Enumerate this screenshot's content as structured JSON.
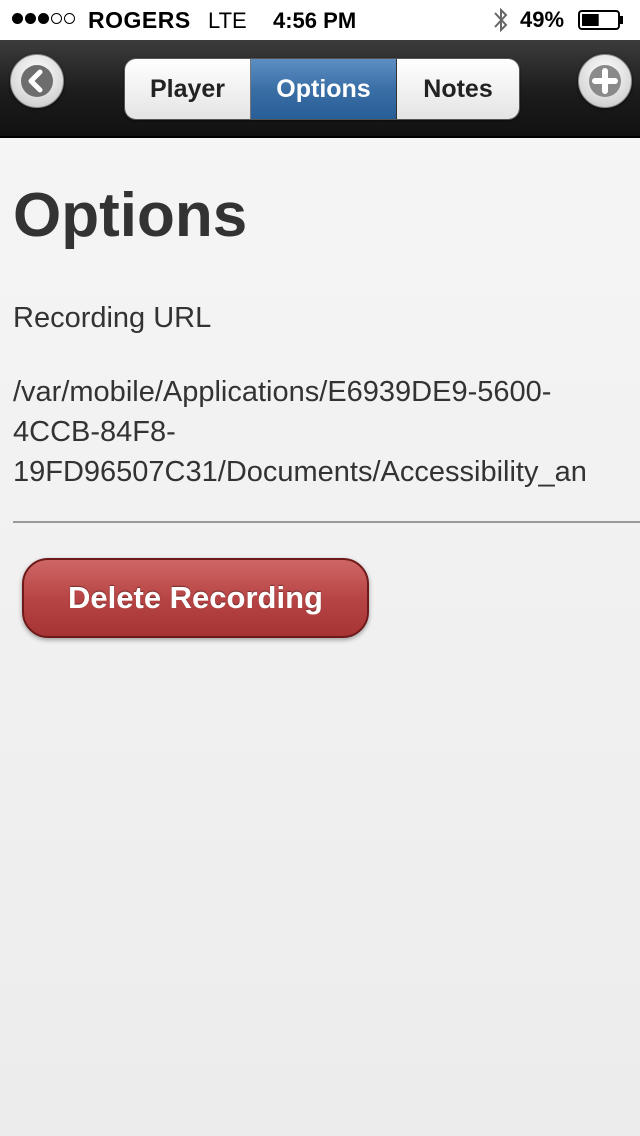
{
  "status_bar": {
    "signal_bars": 3,
    "signal_total": 5,
    "carrier": "ROGERS",
    "network": "LTE",
    "time": "4:56 PM",
    "battery_percent": "49%",
    "battery_level": 0.49,
    "bluetooth_icon": "bluetooth-icon"
  },
  "nav": {
    "back_icon": "chevron-left-icon",
    "add_icon": "plus-icon",
    "tabs": [
      {
        "label": "Player",
        "active": false
      },
      {
        "label": "Options",
        "active": true
      },
      {
        "label": "Notes",
        "active": false
      }
    ]
  },
  "content": {
    "title": "Options",
    "field_label": "Recording URL",
    "url_lines": [
      "/var/mobile/Applications/E6939DE9-5600-",
      "4CCB-84F8-",
      "19FD96507C31/Documents/Accessibility_an"
    ],
    "delete_label": "Delete Recording"
  },
  "colors": {
    "active_tab": "#3a6fa6",
    "delete_button": "#b84545",
    "text": "#333333"
  }
}
